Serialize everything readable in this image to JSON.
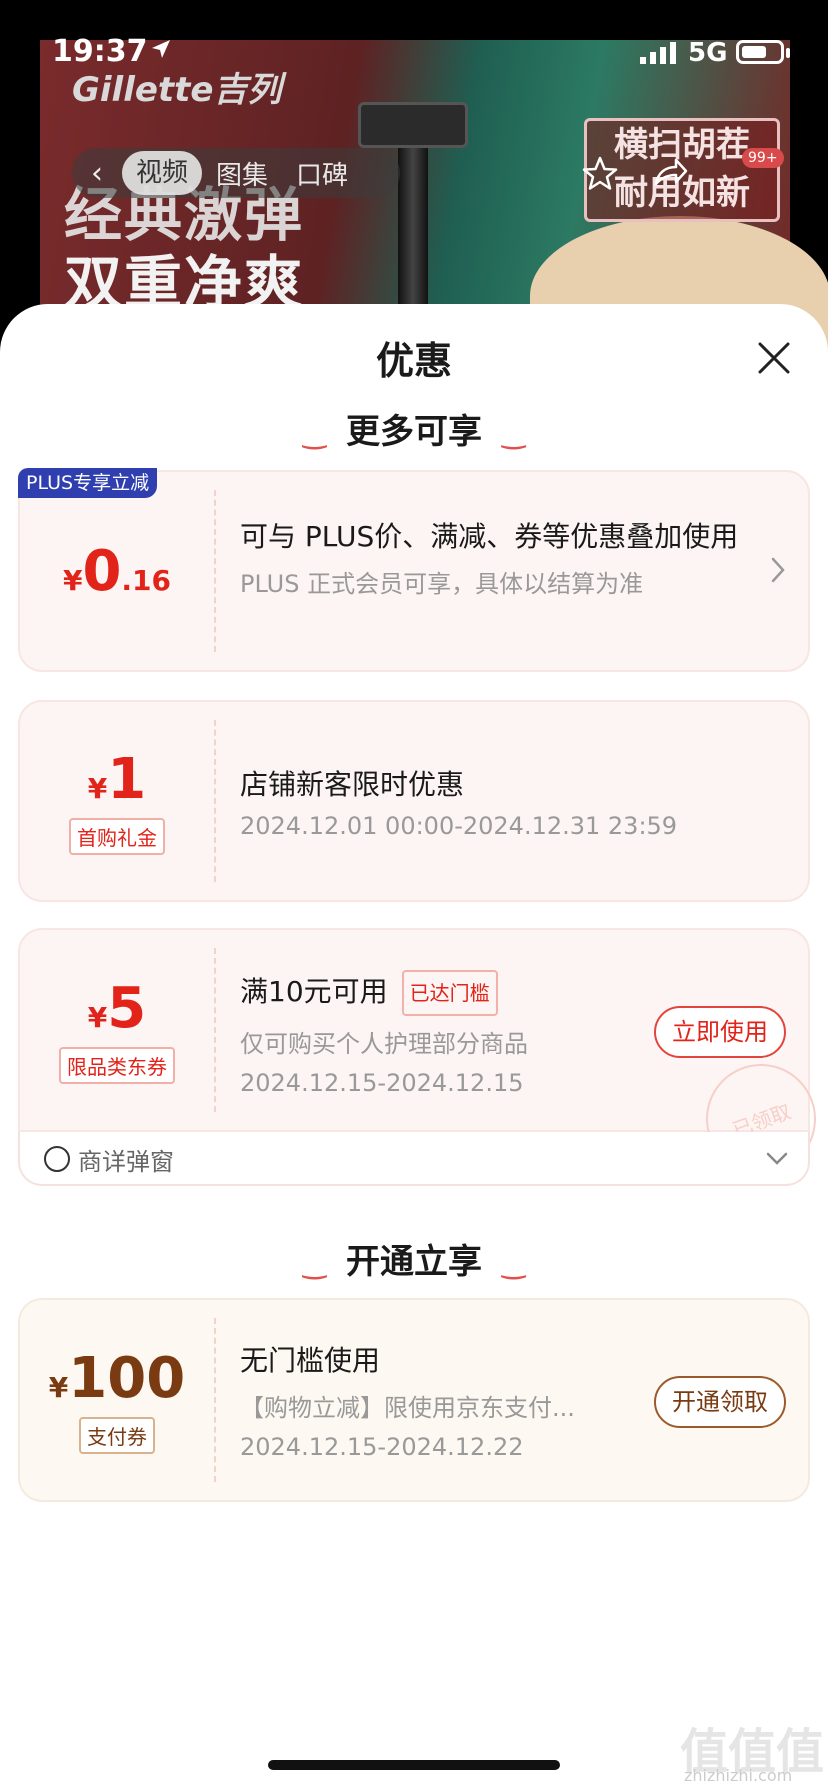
{
  "status_bar": {
    "time": "19:37",
    "network": "5G"
  },
  "banner": {
    "brand": "Gillette吉列",
    "headline_1": "经典激弹",
    "headline_2": "双重净爽",
    "promo_line_1": "横扫胡茬",
    "promo_line_2": "耐用如新",
    "count_badge": "99+",
    "tabs": [
      "视频",
      "图集",
      "口碑"
    ]
  },
  "sheet": {
    "title": "优惠",
    "section_more": "更多可享",
    "section_open": "开通立享"
  },
  "plus_card": {
    "badge": "PLUS专享立减",
    "currency": "¥",
    "int": "0",
    "dec": ".16",
    "line1": "可与 PLUS价、满减、券等优惠叠加使用",
    "line2": "PLUS 正式会员可享，具体以结算为准"
  },
  "new_customer_card": {
    "currency": "¥",
    "amount": "1",
    "tag": "首购礼金",
    "line1": "店铺新客限时优惠",
    "line2": "2024.12.01 00:00-2024.12.31 23:59"
  },
  "coupon_card": {
    "currency": "¥",
    "amount": "5",
    "tag": "限品类东券",
    "line1": "满10元可用",
    "status": "已达门槛",
    "line2": "仅可购买个人护理部分商品",
    "line3": "2024.12.15-2024.12.15",
    "button": "立即使用",
    "stamp": "已领取",
    "footer": "商详弹窗"
  },
  "pay_card": {
    "currency": "¥",
    "amount": "100",
    "tag": "支付券",
    "line1": "无门槛使用",
    "line2": "【购物立减】限使用京东支付...",
    "line3": "2024.12.15-2024.12.22",
    "button": "开通领取"
  },
  "watermark": {
    "mark": "值值值",
    "site": "zhizhizhi.com"
  }
}
